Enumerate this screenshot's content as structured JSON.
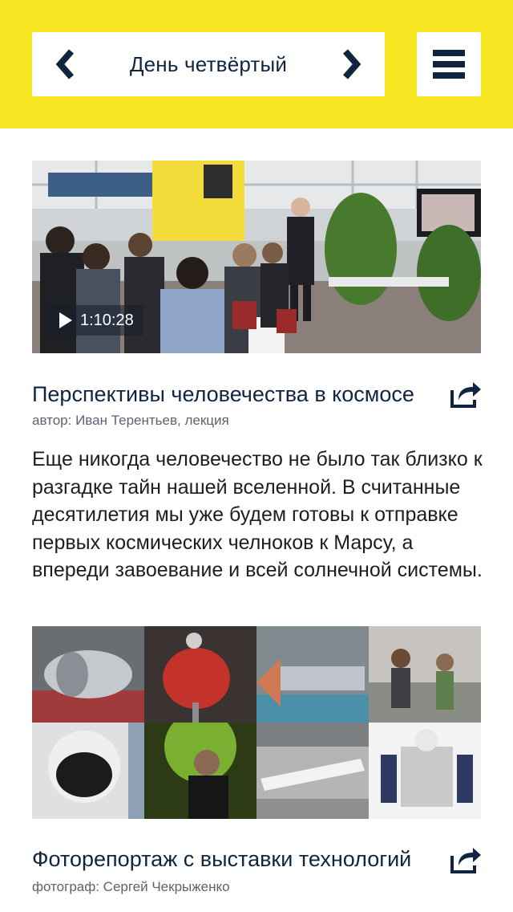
{
  "header": {
    "title": "День четвёртый",
    "prev_icon": "chevron-left-icon",
    "next_icon": "chevron-right-icon",
    "menu_icon": "hamburger-menu-icon",
    "background_color": "#f7e723",
    "accent_color": "#0f2540"
  },
  "articles": [
    {
      "type": "video",
      "duration": "1:10:28",
      "title": "Перспективы человечества в космосе",
      "subtitle": "автор: Иван Терентьев, лекция",
      "description": "Еще никогда человечество не было так близко к разгадке тайн нашей вселенной. В считанные десятилетия мы уже будем готовы к отправке первых космических челноков к Марсу, а впереди завоевание и всей солнечной системы.",
      "share_icon": "share-icon"
    },
    {
      "type": "gallery",
      "title": "Фоторепортаж с выставки технологий",
      "subtitle": "фотограф: Сергей Чекрыженко",
      "share_icon": "share-icon"
    }
  ]
}
